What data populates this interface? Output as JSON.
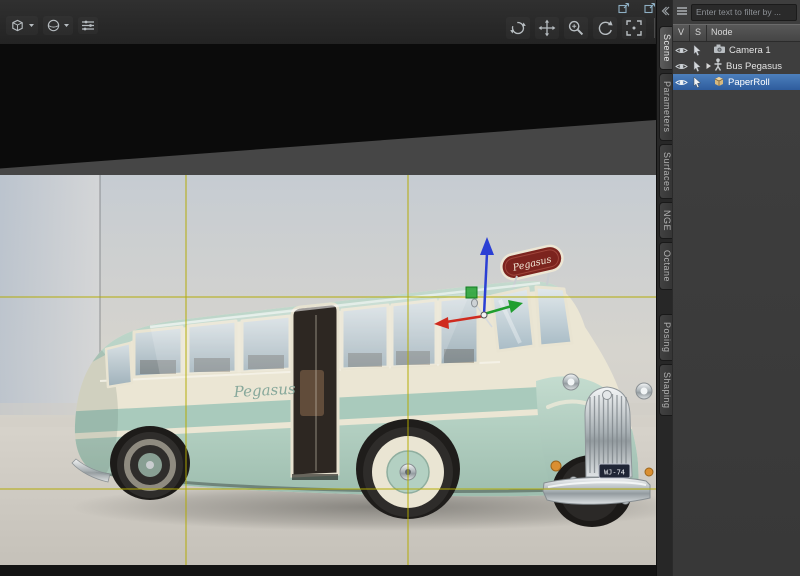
{
  "viewport": {
    "toolbar": {
      "left_icons": [
        "view-selector-icon",
        "draw-style-icon",
        "view-options-icon"
      ],
      "right_icons": [
        "orbit-icon",
        "pan-icon",
        "zoom-icon",
        "undo-icon",
        "frame-icon",
        "compass-icon"
      ],
      "window_icons": [
        "popout-icon",
        "popout-icon"
      ]
    },
    "guides": {
      "vertical_x": [
        186,
        408
      ],
      "horizontal_y": [
        122,
        314
      ],
      "color": "#b3ab00"
    }
  },
  "render": {
    "bus": {
      "roof_sign_text": "Pegasus",
      "side_text": "Pegasus",
      "license_plate": "WJ-74"
    }
  },
  "tabs": [
    {
      "label": "Scene",
      "active": true
    },
    {
      "label": "Parameters",
      "active": false
    },
    {
      "label": "Surfaces",
      "active": false
    },
    {
      "label": "NGE",
      "active": false
    },
    {
      "label": "Octane",
      "active": false
    },
    {
      "label": "Posing",
      "active": false
    },
    {
      "label": "Shaping",
      "active": false
    }
  ],
  "scene_panel": {
    "filter_placeholder": "Enter text to filter by ...",
    "columns": [
      "V",
      "S",
      "Node"
    ],
    "nodes": [
      {
        "label": "Camera 1",
        "type": "camera",
        "selected": false
      },
      {
        "label": "Bus Pegasus",
        "type": "figure",
        "expandable": true,
        "selected": false
      },
      {
        "label": "PaperRoll",
        "type": "prop",
        "selected": true
      }
    ]
  },
  "colors": {
    "selection_blue": "#3f6fae",
    "panel_bg": "#3e3e3e",
    "viewport_black": "#0b0b0b",
    "bus_teal": "#aecdc0",
    "bus_cream": "#ebe6d4",
    "sign_red": "#7c241e",
    "guide_yellow": "#b3ab00"
  }
}
